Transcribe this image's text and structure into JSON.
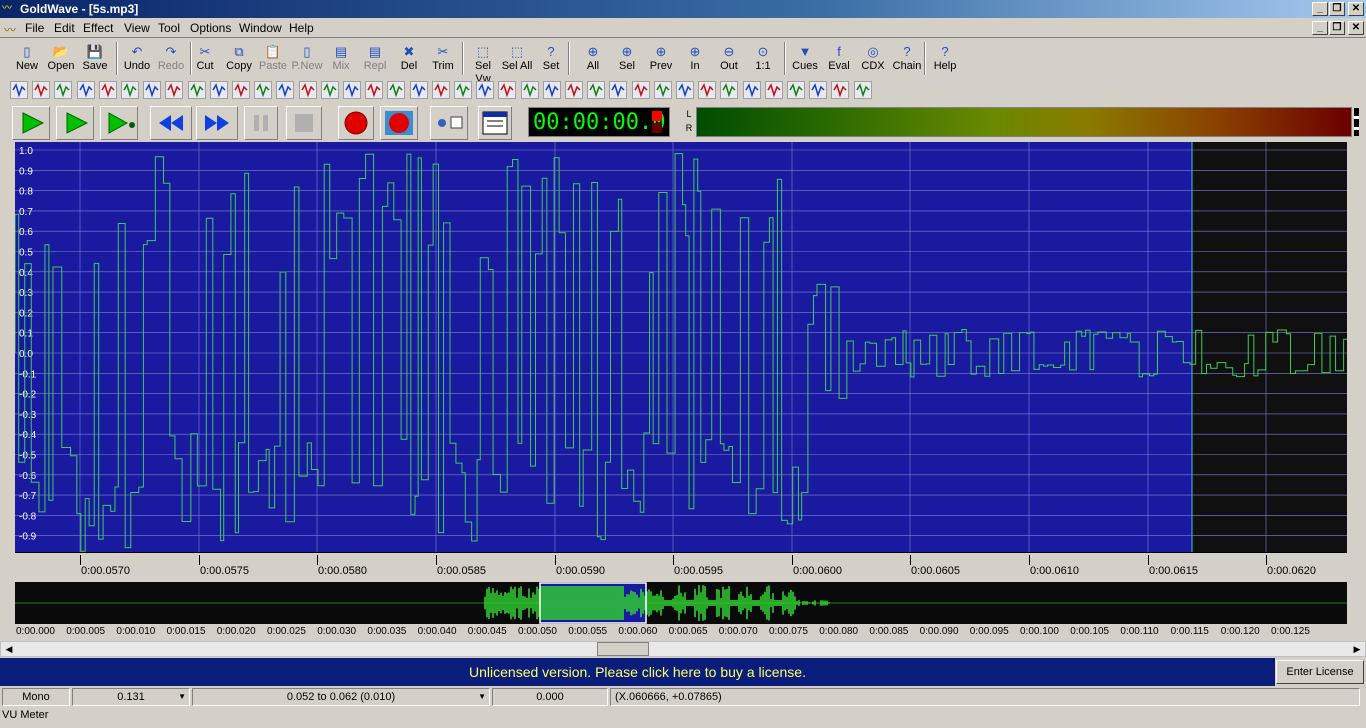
{
  "window": {
    "title": "GoldWave - [5s.mp3]"
  },
  "menu": [
    "File",
    "Edit",
    "Effect",
    "View",
    "Tool",
    "Options",
    "Window",
    "Help"
  ],
  "toolbar": [
    "New",
    "Open",
    "Save",
    "Undo",
    "Redo",
    "Cut",
    "Copy",
    "Paste",
    "P.New",
    "Mix",
    "Repl",
    "Del",
    "Trim",
    "Sel Vw",
    "Sel All",
    "Set",
    "All",
    "Sel",
    "Prev",
    "In",
    "Out",
    "1:1",
    "Cues",
    "Eval",
    "CDX",
    "Chain",
    "Help"
  ],
  "toolbar_disabled": [
    "Redo",
    "Paste",
    "P.New",
    "Mix",
    "Repl"
  ],
  "timer": "00:00:00.0",
  "vu_labels": {
    "l": "L",
    "r": "R"
  },
  "amplitude_ticks": [
    "1.0",
    "0.9",
    "0.8",
    "0.7",
    "0.6",
    "0.5",
    "0.4",
    "0.3",
    "0.2",
    "0.1",
    "0.0",
    "-0.1",
    "-0.2",
    "-0.3",
    "-0.4",
    "-0.5",
    "-0.6",
    "-0.7",
    "-0.8",
    "-0.9"
  ],
  "time_ticks": [
    "0:00.0570",
    "0:00.0575",
    "0:00.0580",
    "0:00.0585",
    "0:00.0590",
    "0:00.0595",
    "0:00.0600",
    "0:00.0605",
    "0:00.0610",
    "0:00.0615",
    "0:00.0620"
  ],
  "overview_ticks": [
    "0:00.000",
    "0:00.005",
    "0:00.010",
    "0:00.015",
    "0:00.020",
    "0:00.025",
    "0:00.030",
    "0:00.035",
    "0:00.040",
    "0:00.045",
    "0:00.050",
    "0:00.055",
    "0:00.060",
    "0:00.065",
    "0:00.070",
    "0:00.075",
    "0:00.080",
    "0:00.085",
    "0:00.090",
    "0:00.095",
    "0:00.100",
    "0:00.105",
    "0:00.110",
    "0:00.115",
    "0:00.120",
    "0:00.125"
  ],
  "banner": "Unlicensed version. Please click here to buy a license.",
  "license_button": "Enter License",
  "status": {
    "channel": "Mono",
    "zoom": "0.131",
    "selection": "0.052 to 0.062 (0.010)",
    "position": "0.000",
    "cursor": "(X.060666, +0.07865)"
  },
  "footer": "VU Meter",
  "colors": {
    "wave_bg": "#1a1aa0",
    "wave": "#3ccc5c",
    "banner_text": "#ffff66"
  }
}
